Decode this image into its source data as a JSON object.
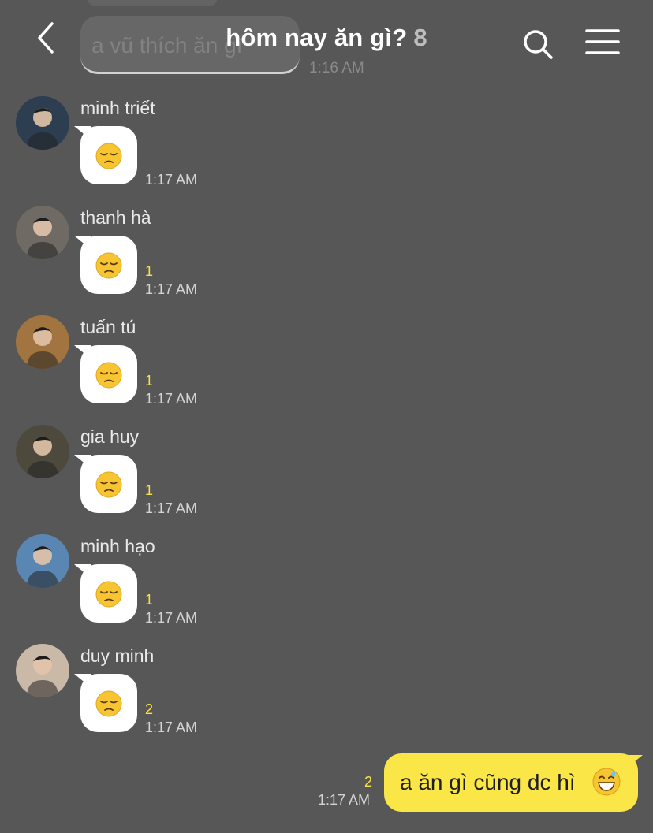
{
  "header": {
    "title": "hôm nay ăn gì?",
    "member_count": "8",
    "back_icon": "chevron-left-icon",
    "search_icon": "search-icon",
    "menu_icon": "hamburger-menu-icon"
  },
  "previous_message": {
    "text": "a vũ thích ăn gì",
    "time": "1:16 AM"
  },
  "messages": [
    {
      "sender": "minh triết",
      "emoji": "pensive-face",
      "unread": "",
      "time": "1:17 AM",
      "avatar_color": "#2c3e50"
    },
    {
      "sender": "thanh hà",
      "emoji": "pensive-face",
      "unread": "1",
      "time": "1:17 AM",
      "avatar_color": "#6f6a63"
    },
    {
      "sender": "tuấn tú",
      "emoji": "pensive-face",
      "unread": "1",
      "time": "1:17 AM",
      "avatar_color": "#a2743f"
    },
    {
      "sender": "gia huy",
      "emoji": "pensive-face",
      "unread": "1",
      "time": "1:17 AM",
      "avatar_color": "#4d4a3d"
    },
    {
      "sender": "minh hạo",
      "emoji": "pensive-face",
      "unread": "1",
      "time": "1:17 AM",
      "avatar_color": "#5a86b3"
    },
    {
      "sender": "duy minh",
      "emoji": "pensive-face",
      "unread": "2",
      "time": "1:17 AM",
      "avatar_color": "#c9b9a6"
    }
  ],
  "my_message": {
    "text": "a ăn gì cũng dc hì",
    "emoji": "grinning-sweat-face",
    "unread": "2",
    "time": "1:17 AM"
  },
  "colors": {
    "background": "#575757",
    "my_bubble": "#fbe648",
    "unread_count": "#f7e14a"
  }
}
